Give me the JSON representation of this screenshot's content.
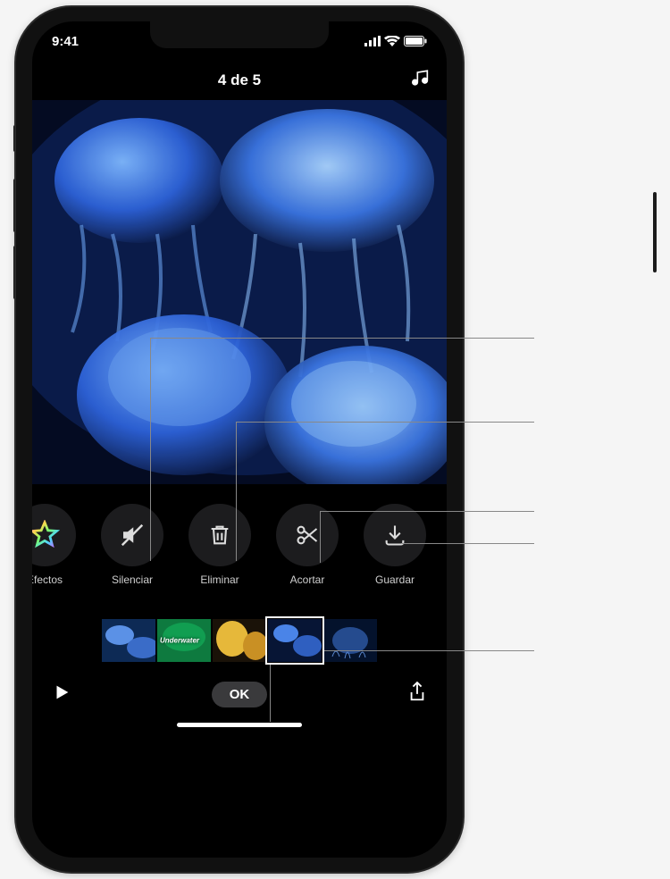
{
  "status": {
    "time": "9:41"
  },
  "nav": {
    "title": "4 de 5"
  },
  "actions": [
    {
      "id": "effects",
      "label": "Efectos",
      "icon": "star",
      "interactable": true
    },
    {
      "id": "mute",
      "label": "Silenciar",
      "icon": "mute",
      "interactable": true
    },
    {
      "id": "delete",
      "label": "Eliminar",
      "icon": "trash",
      "interactable": true
    },
    {
      "id": "trim",
      "label": "Acortar",
      "icon": "scissors",
      "interactable": true
    },
    {
      "id": "save",
      "label": "Guardar",
      "icon": "save",
      "interactable": true
    }
  ],
  "timeline": {
    "clips": [
      {
        "text": ""
      },
      {
        "text": "Underwater"
      },
      {
        "text": ""
      },
      {
        "text": ""
      },
      {
        "text": ""
      }
    ],
    "selected_index": 3
  },
  "bottom": {
    "ok_label": "OK"
  }
}
